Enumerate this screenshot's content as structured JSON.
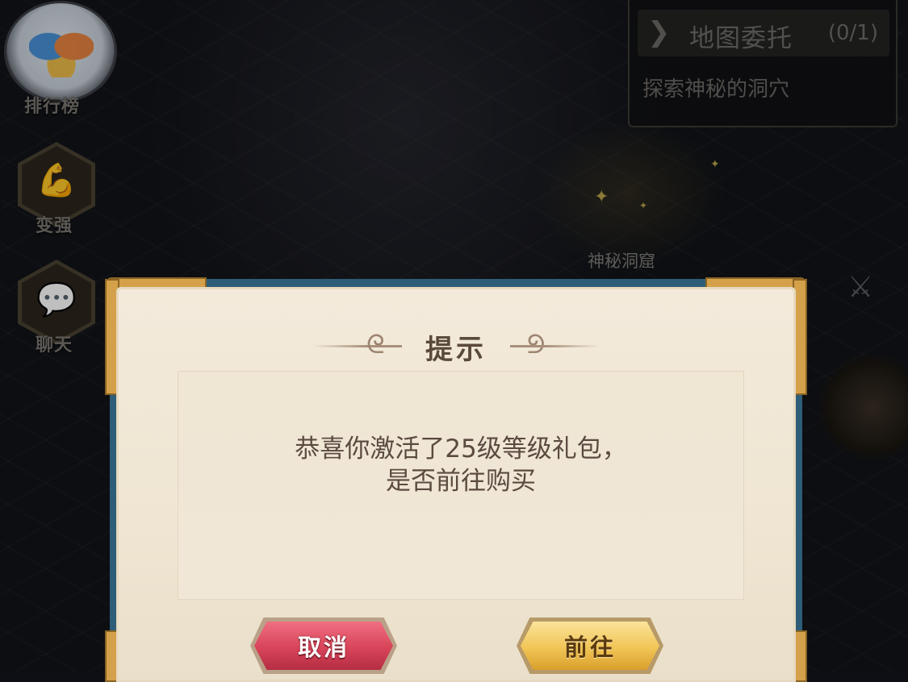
{
  "sidebar": {
    "items": [
      {
        "label": "排行榜",
        "icon": "ranking-avatar-icon"
      },
      {
        "label": "变强",
        "icon": "muscle-icon"
      },
      {
        "label": "聊天",
        "icon": "chat-bubble-icon"
      }
    ]
  },
  "task_panel": {
    "title": "地图委托",
    "count": "(0/1)",
    "description": "探索神秘的洞穴",
    "icon": "chevron-right-icon"
  },
  "map": {
    "location_label": "神秘洞窟"
  },
  "dialog": {
    "title": "提示",
    "message_line1": "恭喜你激活了25级等级礼包，",
    "message_line2": "是否前往购买",
    "cancel_label": "取消",
    "confirm_label": "前往"
  },
  "colors": {
    "cancel_button": "#d84459",
    "confirm_button": "#f1c556",
    "dialog_frame": "#2e5d78",
    "dialog_paper": "#f0e6d3",
    "gold_trim": "#d4a04a"
  }
}
